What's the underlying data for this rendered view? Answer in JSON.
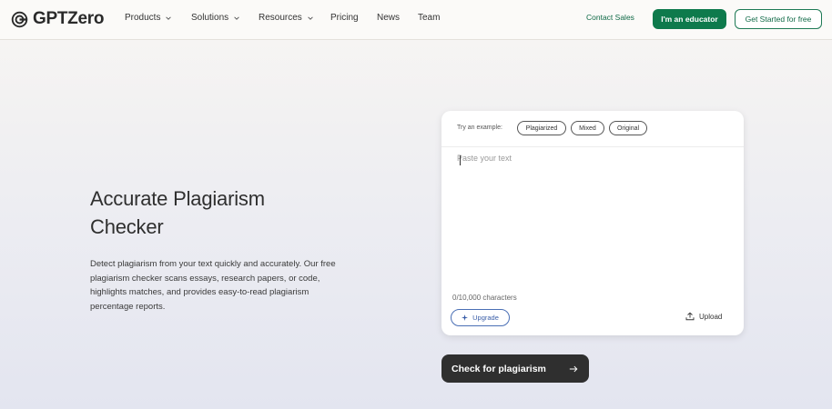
{
  "nav": {
    "logo_text": "GPTZero",
    "items": [
      {
        "label": "Products",
        "has_dropdown": true
      },
      {
        "label": "Solutions",
        "has_dropdown": true
      },
      {
        "label": "Resources",
        "has_dropdown": true
      },
      {
        "label": "Pricing",
        "has_dropdown": false
      },
      {
        "label": "News",
        "has_dropdown": false
      },
      {
        "label": "Team",
        "has_dropdown": false
      }
    ],
    "contact_sales": "Contact Sales",
    "educator_button": "I'm an educator",
    "get_started_button": "Get Started for free"
  },
  "hero": {
    "title_line1": "Accurate Plagiarism",
    "title_line2": "Checker",
    "desc_line1": "Detect plagiarism from your text quickly and accurately. Our free",
    "desc_line2": "plagiarism checker scans essays, research papers, or code,",
    "desc_line3": "highlights matches, and provides easy-to-read plagiarism",
    "desc_line4": "percentage reports."
  },
  "checker": {
    "try_label": "Try an example:",
    "examples": [
      "Plagiarized",
      "Mixed",
      "Original"
    ],
    "text_value": "",
    "placeholder": "Paste your text",
    "char_count": "0/10,000 characters",
    "upgrade_label": "Upgrade",
    "upload_label": "Upload",
    "check_button": "Check for plagiarism"
  },
  "colors": {
    "brand_green": "#0e7a4c",
    "upgrade_blue": "#3a5ea8",
    "dark_button": "#2f2f2f"
  }
}
